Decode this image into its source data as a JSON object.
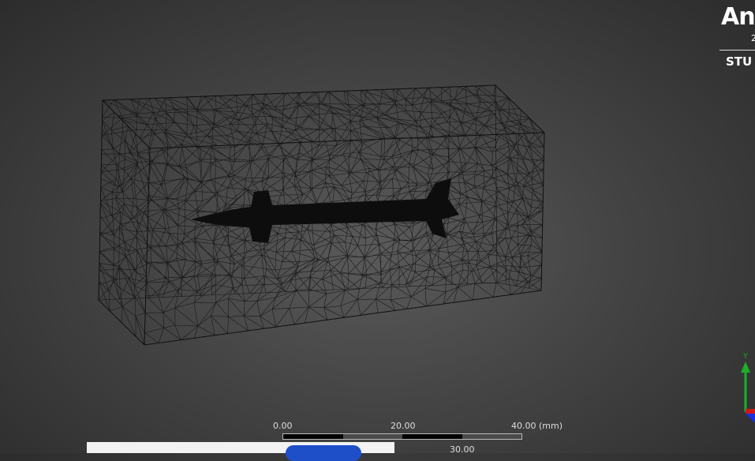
{
  "logo": {
    "brand": "An",
    "year": "2",
    "edition": "STU"
  },
  "scale": {
    "labels": [
      "0.00",
      "20.00",
      "40.00 (mm)"
    ],
    "secondary": "30.00"
  },
  "triad": {
    "y_label": "Y"
  },
  "colors": {
    "mesh": "#111111",
    "axis_y": "#1fae2a",
    "axis_x": "#d01818",
    "axis_z": "#1a2fe0",
    "button": "#1e4fc9"
  }
}
